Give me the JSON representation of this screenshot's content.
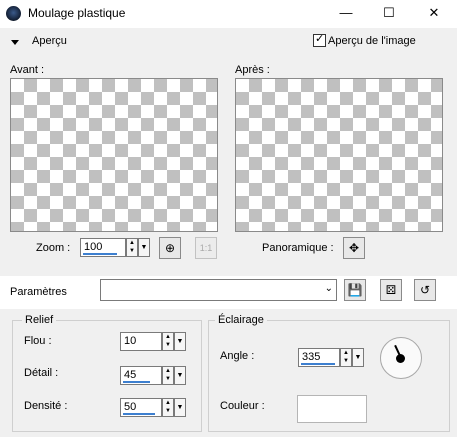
{
  "window": {
    "title": "Moulage plastique",
    "minimize_glyph": "—",
    "maximize_glyph": "☐",
    "close_glyph": "✕"
  },
  "preview": {
    "toggle_label": "Aperçu",
    "show_image_label": "Aperçu de l'image",
    "show_image_checked": true,
    "before_label": "Avant :",
    "after_label": "Après :",
    "zoom_label": "Zoom :",
    "zoom_value": "100",
    "pan_label": "Panoramique :"
  },
  "settings": {
    "label": "Paramètres",
    "preset_value": ""
  },
  "relief": {
    "group_label": "Relief",
    "blur_label": "Flou :",
    "blur_value": "10",
    "detail_label": "Détail :",
    "detail_value": "45",
    "density_label": "Densité :",
    "density_value": "50"
  },
  "lighting": {
    "group_label": "Éclairage",
    "angle_label": "Angle :",
    "angle_value": "335",
    "color_label": "Couleur :"
  },
  "colors": {
    "accent": "#3d7fcf",
    "checker": "#c0c0c0",
    "light_color": "#ffffff"
  },
  "icons": [
    "app-icon",
    "fit-zoom-icon",
    "one-to-one-icon",
    "pan-icon",
    "save-preset-icon",
    "random-icon",
    "reset-icon",
    "angle-dial-icon"
  ]
}
